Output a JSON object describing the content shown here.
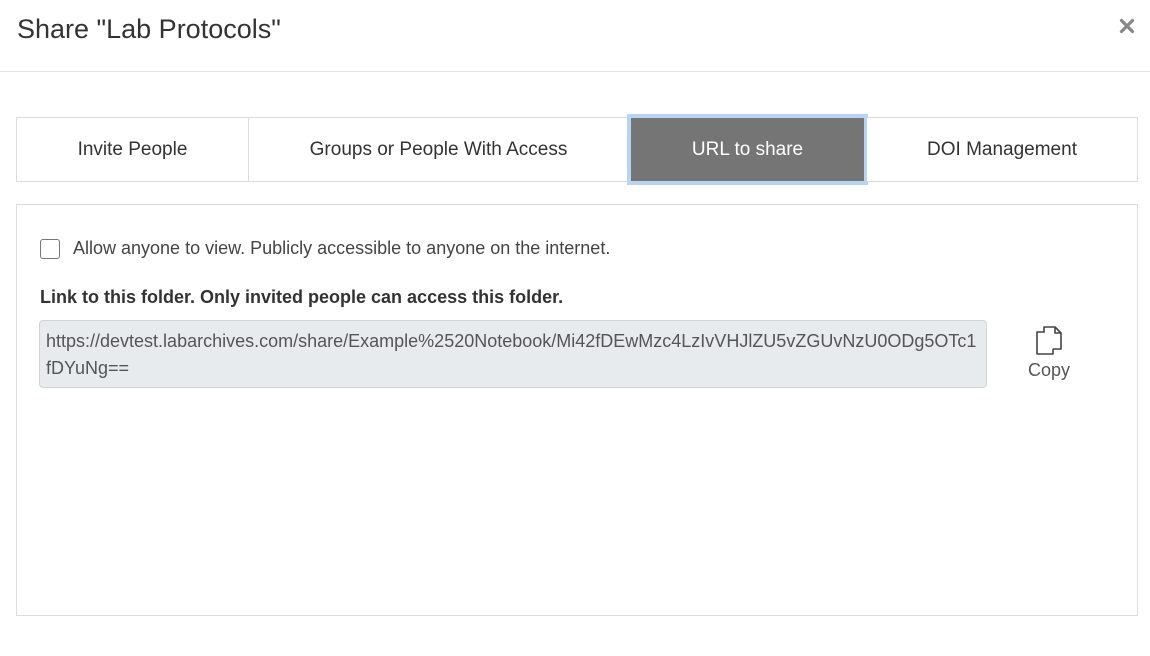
{
  "dialog": {
    "title": "Share \"Lab Protocols\"",
    "close_icon": "close-icon"
  },
  "tabs": [
    {
      "label": "Invite People",
      "active": false
    },
    {
      "label": "Groups or People With Access",
      "active": false
    },
    {
      "label": "URL to share",
      "active": true
    },
    {
      "label": "DOI Management",
      "active": false
    }
  ],
  "panel": {
    "public_checkbox_checked": false,
    "public_label": "Allow anyone to view. Publicly accessible to anyone on the internet.",
    "link_heading": "Link to this folder. Only invited people can access this folder.",
    "share_url": "https://devtest.labarchives.com/share/Example%2520Notebook/Mi42fDEwMzc4LzIvVHJlZU5vZGUvNzU0ODg5OTc1fDYuNg==",
    "copy_label": "Copy",
    "copy_icon": "copy-icon"
  },
  "colors": {
    "active_tab_bg": "#757575",
    "active_tab_focus": "#b8d4f3",
    "url_box_bg": "#e8ebee"
  }
}
